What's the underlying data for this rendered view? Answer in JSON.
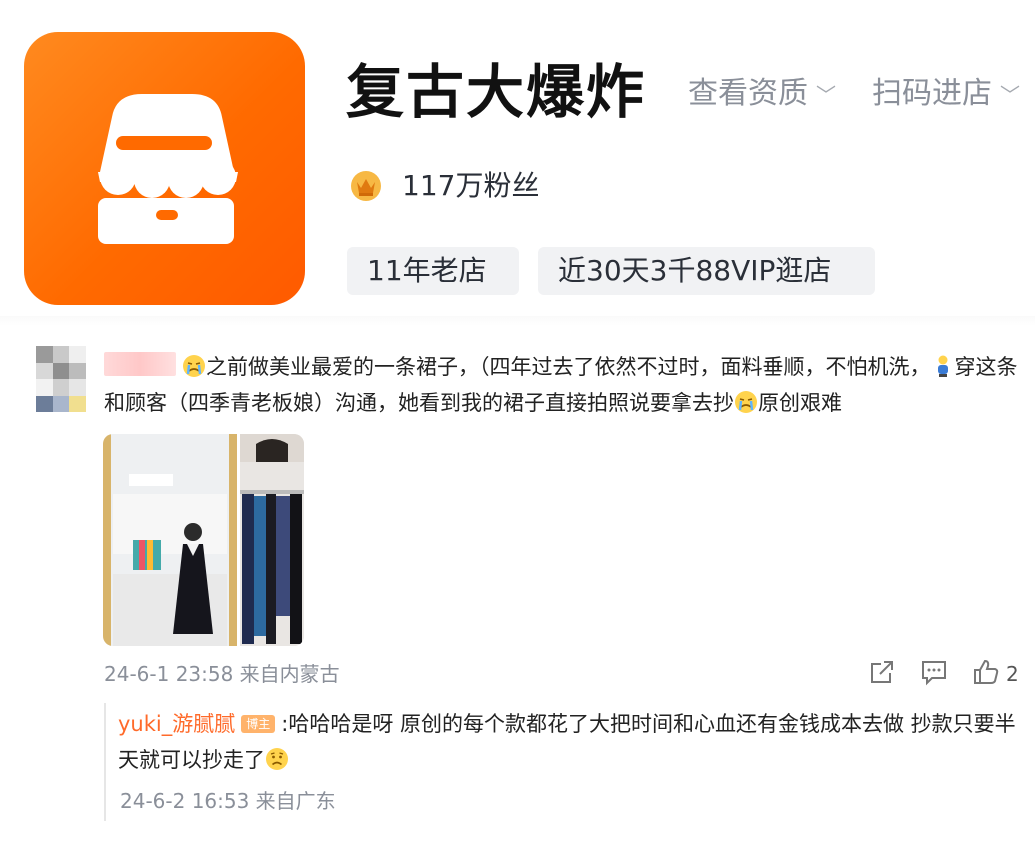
{
  "store": {
    "name": "复古大爆炸",
    "links": [
      "查看资质",
      "扫码进店"
    ],
    "fans": "117万粉丝",
    "tags": [
      "11年老店",
      "近30天3千88VIP逛店"
    ],
    "brand_color": "#ff6a00"
  },
  "comment": {
    "text_part1": "之前做美业最爱的一条裙子，（四年过去了依然不过时，面料垂顺，不怕机洗，",
    "text_part2": "穿这条和顾客（四季青老板娘）沟通，她看到我的裙子直接拍照说要拿去抄",
    "text_part3": "原创艰难",
    "meta": "24-6-1 23:58 来自内蒙古",
    "likes": "2",
    "icons": [
      "crying-emoji-icon",
      "person-emoji-icon",
      "share-icon",
      "comment-icon",
      "like-icon"
    ]
  },
  "reply": {
    "user": "yuki_游腻腻",
    "badge": "博主",
    "text": ":哈哈哈是呀 原创的每个款都花了大把时间和心血还有金钱成本去做 抄款只要半天就可以抄走了",
    "meta": "24-6-2 16:53 来自广东"
  }
}
